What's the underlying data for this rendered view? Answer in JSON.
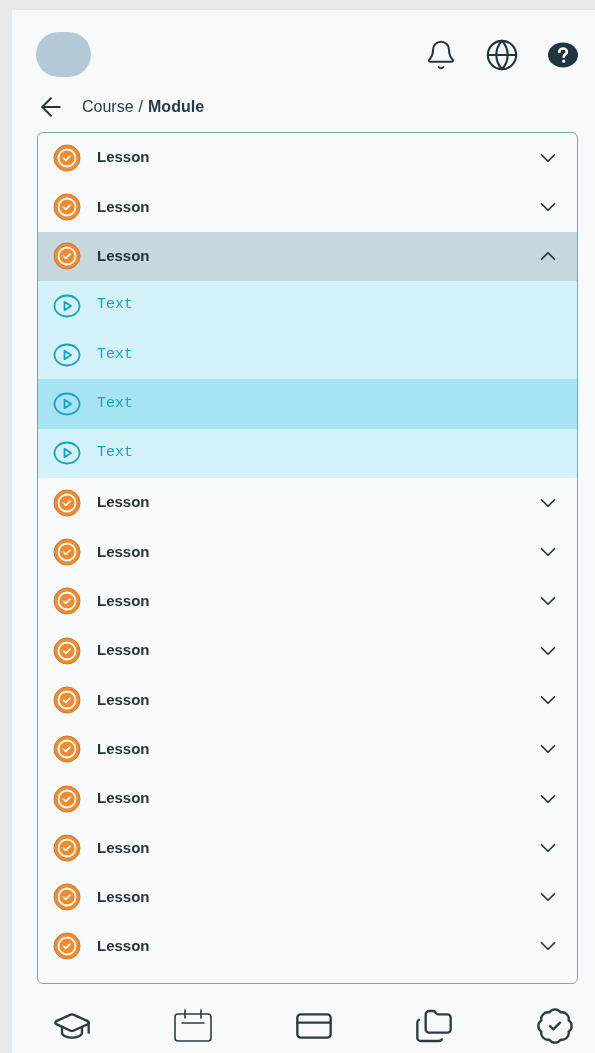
{
  "breadcrumb": {
    "course": "Course",
    "separator": "/",
    "module": "Module"
  },
  "lessons": [
    {
      "title": "Lesson",
      "expanded": false
    },
    {
      "title": "Lesson",
      "expanded": false
    },
    {
      "title": "Lesson",
      "expanded": true,
      "children": [
        {
          "title": "Text",
          "selected": false
        },
        {
          "title": "Text",
          "selected": false
        },
        {
          "title": "Text",
          "selected": true
        },
        {
          "title": "Text",
          "selected": false
        }
      ]
    },
    {
      "title": "Lesson",
      "expanded": false
    },
    {
      "title": "Lesson",
      "expanded": false
    },
    {
      "title": "Lesson",
      "expanded": false
    },
    {
      "title": "Lesson",
      "expanded": false
    },
    {
      "title": "Lesson",
      "expanded": false
    },
    {
      "title": "Lesson",
      "expanded": false
    },
    {
      "title": "Lesson",
      "expanded": false
    },
    {
      "title": "Lesson",
      "expanded": false
    },
    {
      "title": "Lesson",
      "expanded": false
    },
    {
      "title": "Lesson",
      "expanded": false
    }
  ]
}
